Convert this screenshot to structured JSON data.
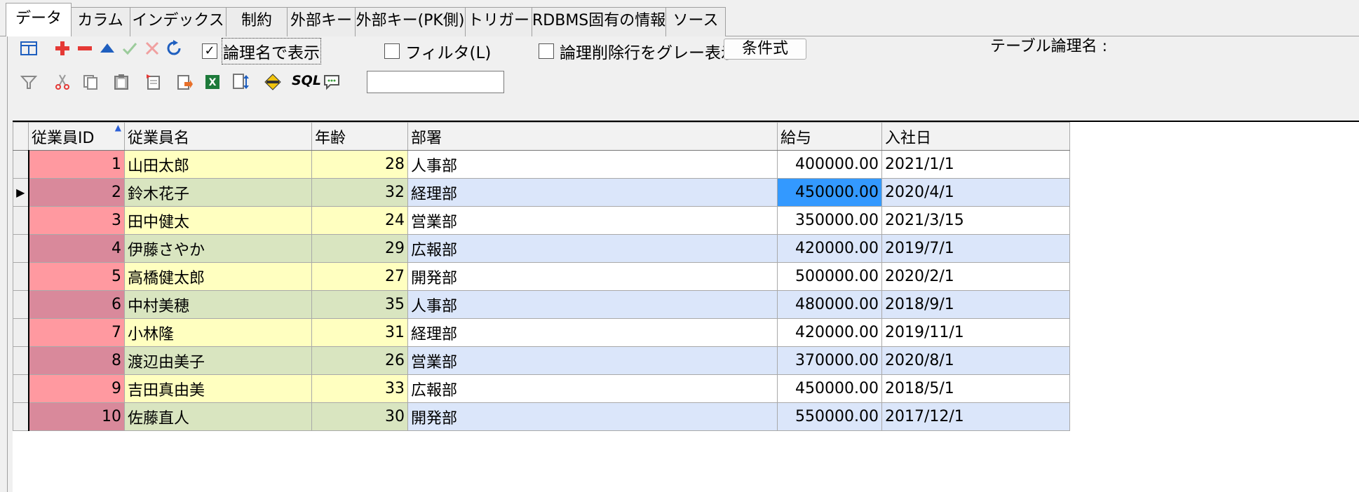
{
  "tabs": [
    {
      "label": "データ",
      "active": true
    },
    {
      "label": "カラム"
    },
    {
      "label": "インデックス"
    },
    {
      "label": "制約"
    },
    {
      "label": "外部キー"
    },
    {
      "label": "外部キー(PK側)"
    },
    {
      "label": "トリガー"
    },
    {
      "label": "RDBMS固有の情報"
    },
    {
      "label": "ソース"
    }
  ],
  "toolbar": {
    "show_logical_name": "論理名で表示",
    "filter": "フィルタ(L)",
    "gray_deleted": "論理削除行をグレー表示",
    "condition_button": "条件式",
    "table_logical_name_label": "テーブル論理名 :",
    "sql_label": "SQL",
    "filter_input_value": ""
  },
  "colors": {
    "add": "#e53935",
    "remove": "#e53935",
    "up": "#1f5fbf",
    "ok": "#9ccc9c",
    "cancel": "#f0a0a0",
    "refresh": "#1f5fbf",
    "selected_cell": "#3399ff"
  },
  "grid": {
    "columns": [
      "従業員ID",
      "従業員名",
      "年齢",
      "部署",
      "給与",
      "入社日"
    ],
    "rows": [
      {
        "id": "1",
        "name": "山田太郎",
        "age": "28",
        "dept": "人事部",
        "salary": "400000.00",
        "hired": "2021/1/1"
      },
      {
        "id": "2",
        "name": "鈴木花子",
        "age": "32",
        "dept": "経理部",
        "salary": "450000.00",
        "hired": "2020/4/1"
      },
      {
        "id": "3",
        "name": "田中健太",
        "age": "24",
        "dept": "営業部",
        "salary": "350000.00",
        "hired": "2021/3/15"
      },
      {
        "id": "4",
        "name": "伊藤さやか",
        "age": "29",
        "dept": "広報部",
        "salary": "420000.00",
        "hired": "2019/7/1"
      },
      {
        "id": "5",
        "name": "高橋健太郎",
        "age": "27",
        "dept": "開発部",
        "salary": "500000.00",
        "hired": "2020/2/1"
      },
      {
        "id": "6",
        "name": "中村美穂",
        "age": "35",
        "dept": "人事部",
        "salary": "480000.00",
        "hired": "2018/9/1"
      },
      {
        "id": "7",
        "name": "小林隆",
        "age": "31",
        "dept": "経理部",
        "salary": "420000.00",
        "hired": "2019/11/1"
      },
      {
        "id": "8",
        "name": "渡辺由美子",
        "age": "26",
        "dept": "営業部",
        "salary": "370000.00",
        "hired": "2020/8/1"
      },
      {
        "id": "9",
        "name": "吉田真由美",
        "age": "33",
        "dept": "広報部",
        "salary": "450000.00",
        "hired": "2018/5/1"
      },
      {
        "id": "10",
        "name": "佐藤直人",
        "age": "30",
        "dept": "開発部",
        "salary": "550000.00",
        "hired": "2017/12/1"
      }
    ],
    "current_row_marker": "▶"
  }
}
